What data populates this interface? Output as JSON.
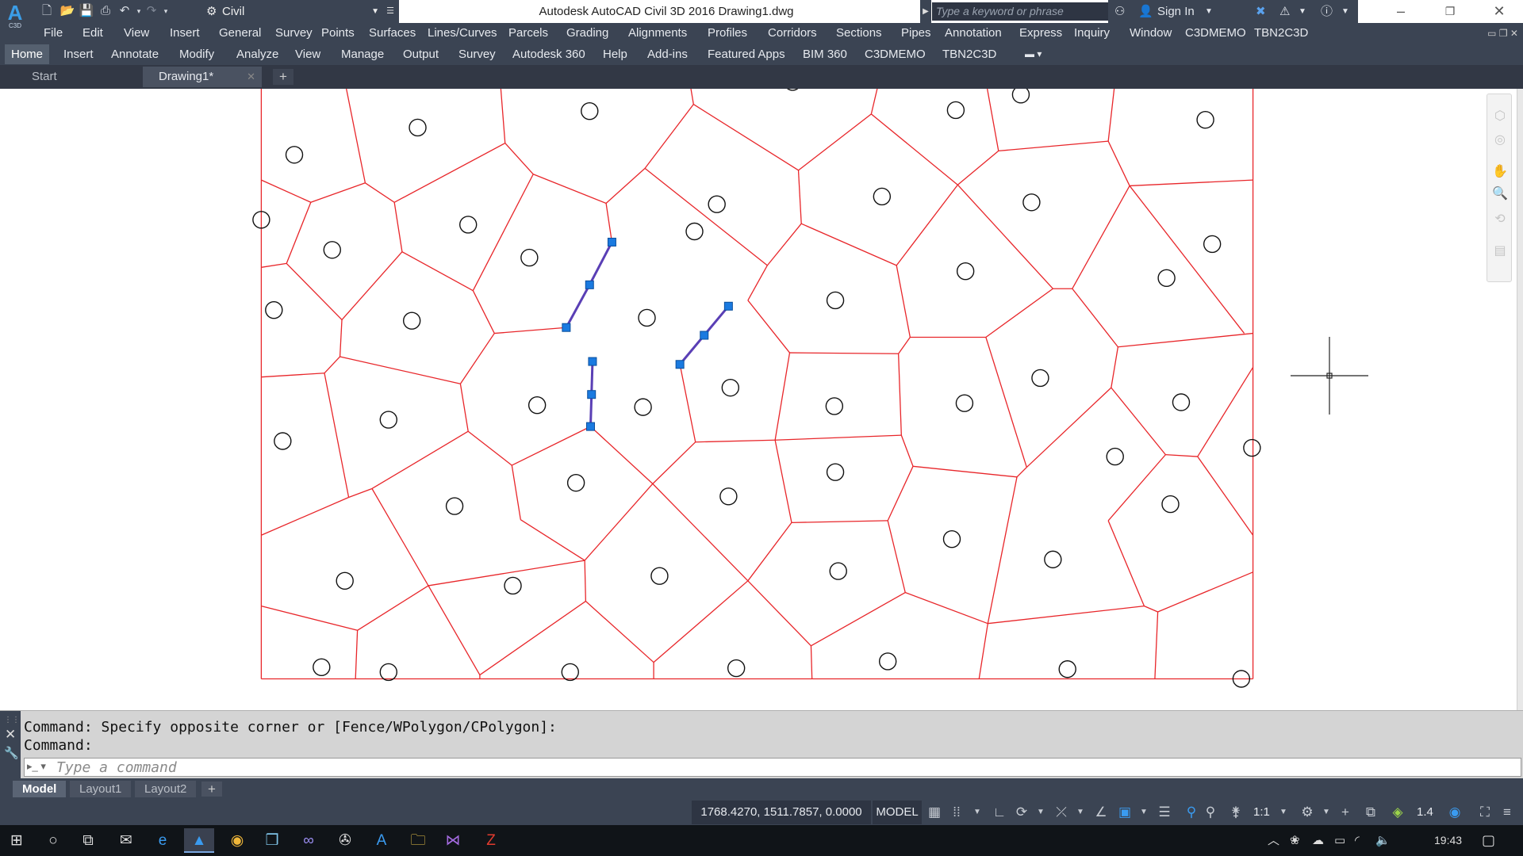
{
  "app": {
    "title": "Autodesk AutoCAD Civil 3D 2016    Drawing1.dwg",
    "logo_letter": "A",
    "logo_sub": "C3D",
    "workspace": "Civil",
    "search_placeholder": "Type a keyword or phrase",
    "sign_in": "Sign In"
  },
  "menu": [
    "File",
    "Edit",
    "View",
    "Insert",
    "General",
    "Survey",
    "Points",
    "Surfaces",
    "Lines/Curves",
    "Parcels",
    "Grading",
    "Alignments",
    "Profiles",
    "Corridors",
    "Sections",
    "Pipes",
    "Annotation",
    "Express",
    "Inquiry",
    "Window",
    "C3DMEMO",
    "TBN2C3D"
  ],
  "ribbon_tabs": [
    "Home",
    "Insert",
    "Annotate",
    "Modify",
    "Analyze",
    "View",
    "Manage",
    "Output",
    "Survey",
    "Autodesk 360",
    "Help",
    "Add-ins",
    "Featured Apps",
    "BIM 360",
    "C3DMEMO",
    "TBN2C3D"
  ],
  "doc_tabs": [
    "Start",
    "Drawing1*"
  ],
  "command": {
    "history": [
      "Command: Specify opposite corner or [Fence/WPolygon/CPolygon]:",
      "Command:"
    ],
    "placeholder": "Type a command"
  },
  "layout_tabs": [
    "Model",
    "Layout1",
    "Layout2"
  ],
  "status": {
    "coords": "1768.4270, 1511.7857, 0.0000",
    "model": "MODEL",
    "scale": "1:1",
    "lineweight": "1.4"
  },
  "taskbar": {
    "time": "19:43"
  },
  "colors": {
    "chrome_dark": "#3b4453",
    "voronoi_line": "#e8262a",
    "selected_line": "#5a3fb5",
    "grip": "#1a7ae0"
  }
}
